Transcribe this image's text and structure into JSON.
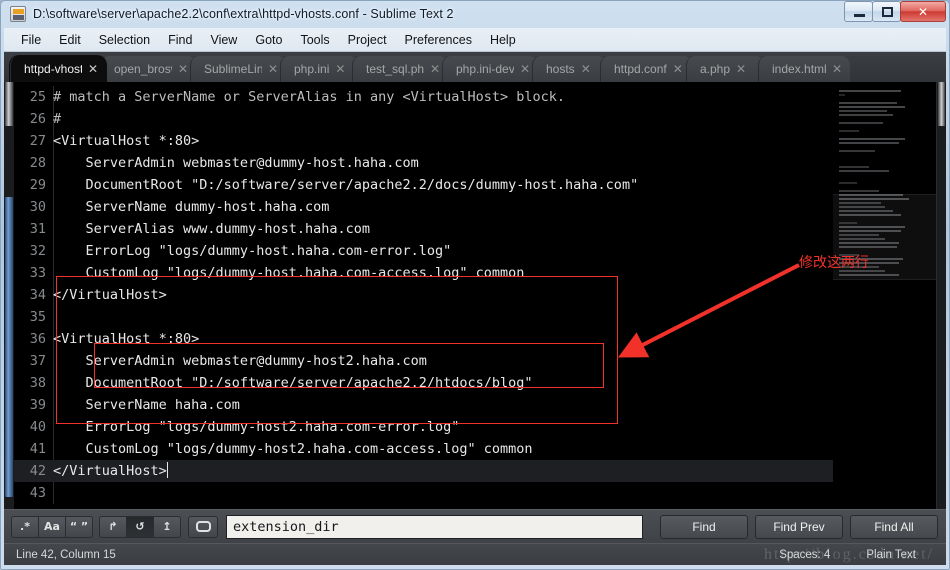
{
  "window": {
    "title": "D:\\software\\server\\apache2.2\\conf\\extra\\httpd-vhosts.conf - Sublime Text 2",
    "minimize_label": "–",
    "maximize_label": "□",
    "close_label": "✕"
  },
  "menubar": {
    "items": [
      "File",
      "Edit",
      "Selection",
      "Find",
      "View",
      "Goto",
      "Tools",
      "Project",
      "Preferences",
      "Help"
    ]
  },
  "tabs": [
    {
      "label": "httpd-vhosts",
      "close": "✕",
      "active": true
    },
    {
      "label": "open_brosw",
      "close": "✕",
      "active": false
    },
    {
      "label": "SublimeLinte",
      "close": "✕",
      "active": false
    },
    {
      "label": "php.ini",
      "close": "✕",
      "active": false
    },
    {
      "label": "test_sql.php",
      "close": "✕",
      "active": false
    },
    {
      "label": "php.ini-deve",
      "close": "✕",
      "active": false
    },
    {
      "label": "hosts",
      "close": "✕",
      "active": false
    },
    {
      "label": "httpd.conf",
      "close": "✕",
      "active": false
    },
    {
      "label": "a.php",
      "close": "✕",
      "active": false
    },
    {
      "label": "index.html",
      "close": "✕",
      "active": false
    }
  ],
  "editor": {
    "lines": [
      {
        "number": "25",
        "text": "# match a ServerName or ServerAlias in any <VirtualHost> block.",
        "comment": true,
        "fold": false
      },
      {
        "number": "26",
        "text": "#",
        "comment": true,
        "fold": false
      },
      {
        "number": "27",
        "text": "<VirtualHost *:80>",
        "comment": false,
        "fold": true
      },
      {
        "number": "28",
        "text": "    ServerAdmin webmaster@dummy-host.haha.com",
        "comment": false,
        "fold": false
      },
      {
        "number": "29",
        "text": "    DocumentRoot \"D:/software/server/apache2.2/docs/dummy-host.haha.com\"",
        "comment": false,
        "fold": false
      },
      {
        "number": "30",
        "text": "    ServerName dummy-host.haha.com",
        "comment": false,
        "fold": false
      },
      {
        "number": "31",
        "text": "    ServerAlias www.dummy-host.haha.com",
        "comment": false,
        "fold": false
      },
      {
        "number": "32",
        "text": "    ErrorLog \"logs/dummy-host.haha.com-error.log\"",
        "comment": false,
        "fold": false
      },
      {
        "number": "33",
        "text": "    CustomLog \"logs/dummy-host.haha.com-access.log\" common",
        "comment": false,
        "fold": false
      },
      {
        "number": "34",
        "text": "</VirtualHost>",
        "comment": false,
        "fold": false
      },
      {
        "number": "35",
        "text": "",
        "comment": false,
        "fold": false
      },
      {
        "number": "36",
        "text": "<VirtualHost *:80>",
        "comment": false,
        "fold": true
      },
      {
        "number": "37",
        "text": "    ServerAdmin webmaster@dummy-host2.haha.com",
        "comment": false,
        "fold": false
      },
      {
        "number": "38",
        "text": "    DocumentRoot \"D:/software/server/apache2.2/htdocs/blog\"",
        "comment": false,
        "fold": false
      },
      {
        "number": "39",
        "text": "    ServerName haha.com",
        "comment": false,
        "fold": false
      },
      {
        "number": "40",
        "text": "    ErrorLog \"logs/dummy-host2.haha.com-error.log\"",
        "comment": false,
        "fold": false
      },
      {
        "number": "41",
        "text": "    CustomLog \"logs/dummy-host2.haha.com-access.log\" common",
        "comment": false,
        "fold": false
      },
      {
        "number": "42",
        "text": "</VirtualHost>",
        "comment": false,
        "fold": false,
        "current": true,
        "caret": true
      },
      {
        "number": "43",
        "text": "",
        "comment": false,
        "fold": false
      }
    ]
  },
  "annotation": {
    "text": "修改这两行",
    "color": "#f2322a"
  },
  "findbar": {
    "toggles": [
      {
        "name": "regex",
        "label": ".*",
        "on": false
      },
      {
        "name": "case-sensitive",
        "label": "Aa",
        "on": false
      },
      {
        "name": "whole-word",
        "label": "“ ”",
        "on": false
      }
    ],
    "toggles2": [
      {
        "name": "wrap",
        "label": "↱",
        "on": false
      },
      {
        "name": "in-selection",
        "label": "↺",
        "on": true
      },
      {
        "name": "highlight",
        "label": "↥",
        "on": false
      }
    ],
    "preserve_case_name": "preserve-case",
    "input_value": "extension_dir",
    "input_placeholder": "Find",
    "buttons": [
      "Find",
      "Find Prev",
      "Find All"
    ]
  },
  "statusbar": {
    "position": "Line 42, Column 15",
    "indent": "Spaces: 4",
    "syntax": "Plain Text",
    "watermark": "http://blog.csdn.net/"
  }
}
